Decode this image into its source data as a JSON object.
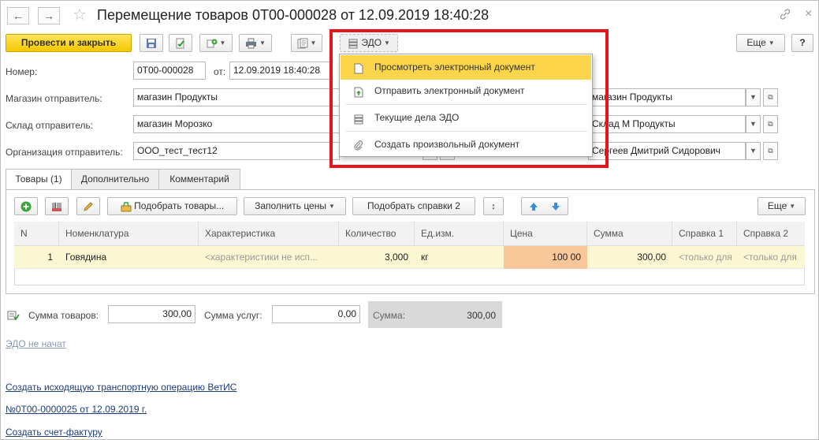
{
  "window": {
    "title": "Перемещение товаров 0Т00-000028 от 12.09.2019 18:40:28",
    "back_glyph": "←",
    "forward_glyph": "→",
    "link_glyph": "🔗",
    "close_glyph": "×"
  },
  "toolbar": {
    "post_close_label": "Провести и закрыть",
    "edo_label": "ЭДО",
    "more_label": "Еще",
    "help_label": "?"
  },
  "form": {
    "number_label": "Номер:",
    "number_value": "0Т00-000028",
    "date_label": "от:",
    "date_value": "12.09.2019 18:40:28",
    "store_sender_label": "Магазин отправитель:",
    "store_sender_value": "магазин Продукты",
    "store_receiver_value": "магазин Продукты",
    "warehouse_sender_label": "Склад отправитель:",
    "warehouse_sender_value": "магазин Морозко",
    "warehouse_receiver_value": "Склад М Продукты",
    "org_sender_label": "Организация отправитель:",
    "org_sender_value": "ООО_тест_тест12",
    "responsible_value": "Сергеев Дмитрий Сидорович"
  },
  "edo_menu": {
    "items": [
      {
        "label": "Просмотреть электронный документ",
        "icon": "document-icon",
        "highlighted": true
      },
      {
        "label": "Отправить электронный документ",
        "icon": "send-document-icon",
        "highlighted": false
      },
      {
        "label": "Текущие дела ЭДО",
        "icon": "edo-tasks-icon",
        "highlighted": false
      },
      {
        "label": "Создать произвольный документ",
        "icon": "paperclip-icon",
        "highlighted": false
      }
    ]
  },
  "tabs": [
    {
      "label": "Товары (1)",
      "active": true
    },
    {
      "label": "Дополнительно",
      "active": false
    },
    {
      "label": "Комментарий",
      "active": false
    }
  ],
  "grid_toolbar": {
    "pick_goods_label": "Подобрать товары...",
    "fill_prices_label": "Заполнить цены",
    "pick_certs_label": "Подобрать справки 2",
    "more_label": "Еще"
  },
  "grid": {
    "columns": [
      "N",
      "Номенклатура",
      "Характеристика",
      "Количество",
      "Ед.изм.",
      "Цена",
      "Сумма",
      "Справка 1",
      "Справка 2"
    ],
    "rows": [
      {
        "n": "1",
        "item": "Говядина",
        "characteristic": "<характеристики не исп...",
        "qty": "3,000",
        "unit": "кг",
        "price": "100 00",
        "sum": "300,00",
        "cert1": "<только для",
        "cert2": "<только для"
      }
    ]
  },
  "totals": {
    "goods_label": "Сумма товаров:",
    "goods_value": "300,00",
    "services_label": "Сумма услуг:",
    "services_value": "0,00",
    "total_label": "Сумма:",
    "total_value": "300,00"
  },
  "links": {
    "edo_status": "ЭДО не начат",
    "vetis": "Создать исходящую транспортную операцию ВетИС",
    "based_doc": "№0Т00-0000025 от 12.09.2019 г.",
    "invoice": "Создать счет-фактуру"
  },
  "colors": {
    "accent_yellow": "#f5c700",
    "menu_highlight": "#fcd54a",
    "row_highlight": "#fbf7d3",
    "price_cell": "#f9c79a",
    "red_frame": "#e8141c",
    "link_blue": "#1d3c7c"
  }
}
